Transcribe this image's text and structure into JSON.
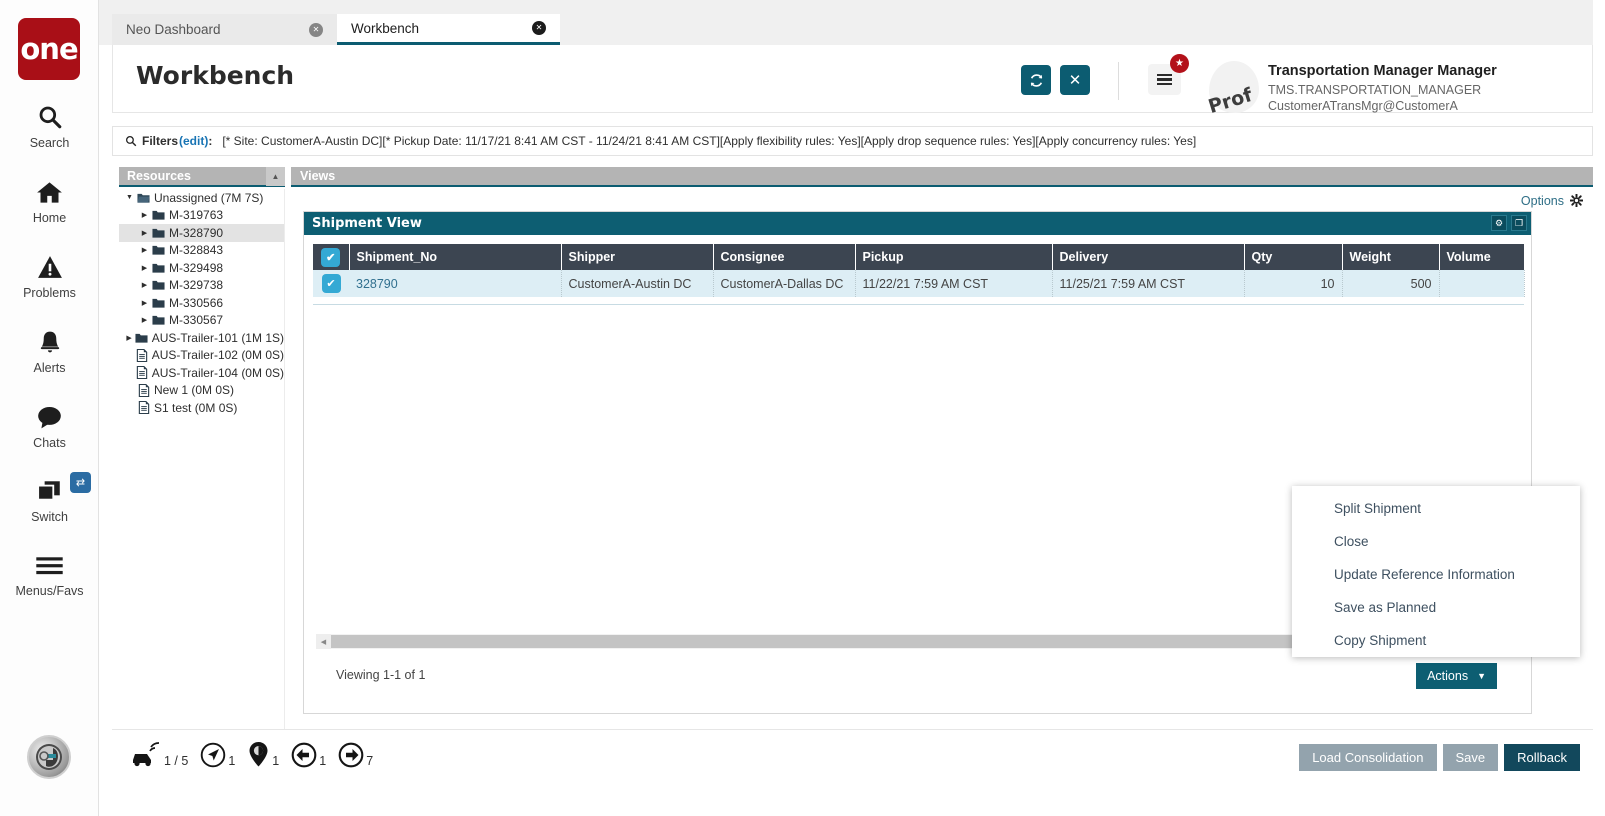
{
  "brand": {
    "logo_text": "one",
    "logo_color": "#a90f17"
  },
  "rail": {
    "items": [
      {
        "label": "Search",
        "icon": "search-icon"
      },
      {
        "label": "Home",
        "icon": "home-icon"
      },
      {
        "label": "Problems",
        "icon": "warning-triangle-icon"
      },
      {
        "label": "Alerts",
        "icon": "bell-icon"
      },
      {
        "label": "Chats",
        "icon": "chat-bubble-icon"
      },
      {
        "label": "Switch",
        "icon": "switch-windows-icon",
        "badge_icon": "swap-arrows-icon"
      },
      {
        "label": "Menus/Favs",
        "icon": "hamburger-icon"
      }
    ],
    "assistant_avatar": "ai-assistant-avatar"
  },
  "tabs": [
    {
      "label": "Neo Dashboard",
      "active": false
    },
    {
      "label": "Workbench",
      "active": true
    }
  ],
  "header": {
    "title": "Workbench",
    "refresh_icon": "refresh-icon",
    "close_icon": "close-icon",
    "menu_icon": "hamburger-icon",
    "badge_icon": "star-icon",
    "avatar_text": "Prof",
    "user_name": "Transportation Manager Manager",
    "user_role": "TMS.TRANSPORTATION_MANAGER",
    "user_email": "CustomerATransMgr@CustomerA",
    "caret_icon": "chevron-down-icon"
  },
  "filters": {
    "icon": "search-icon",
    "label": "Filters",
    "edit_link": "(edit)",
    "colon": ":",
    "value": "[* Site: CustomerA-Austin DC][* Pickup Date: 11/17/21 8:41 AM CST - 11/24/21 8:41 AM CST][Apply flexibility rules: Yes][Apply drop sequence rules: Yes][Apply concurrency rules: Yes]"
  },
  "panes": {
    "resources_header": "Resources",
    "resources_collapse_icon": "chevron-up-icon",
    "views_header": "Views"
  },
  "tree": [
    {
      "label": "Unassigned (7M 7S)",
      "depth": 0,
      "caret": "down",
      "icon": "folder-open-icon",
      "selected": false
    },
    {
      "label": "M-319763",
      "depth": 1,
      "caret": "right",
      "icon": "folder-icon",
      "selected": false
    },
    {
      "label": "M-328790",
      "depth": 1,
      "caret": "right",
      "icon": "folder-icon",
      "selected": true
    },
    {
      "label": "M-328843",
      "depth": 1,
      "caret": "right",
      "icon": "folder-icon",
      "selected": false
    },
    {
      "label": "M-329498",
      "depth": 1,
      "caret": "right",
      "icon": "folder-icon",
      "selected": false
    },
    {
      "label": "M-329738",
      "depth": 1,
      "caret": "right",
      "icon": "folder-icon",
      "selected": false
    },
    {
      "label": "M-330566",
      "depth": 1,
      "caret": "right",
      "icon": "folder-icon",
      "selected": false
    },
    {
      "label": "M-330567",
      "depth": 1,
      "caret": "right",
      "icon": "folder-icon",
      "selected": false
    },
    {
      "label": "AUS-Trailer-101 (1M 1S)",
      "depth": 0,
      "caret": "right",
      "icon": "folder-icon",
      "selected": false
    },
    {
      "label": "AUS-Trailer-102 (0M 0S)",
      "depth": 0,
      "caret": "none",
      "icon": "document-icon",
      "selected": false
    },
    {
      "label": "AUS-Trailer-104 (0M 0S)",
      "depth": 0,
      "caret": "none",
      "icon": "document-icon",
      "selected": false
    },
    {
      "label": "New 1 (0M 0S)",
      "depth": 0,
      "caret": "none",
      "icon": "document-icon",
      "selected": false
    },
    {
      "label": "S1 test (0M 0S)",
      "depth": 0,
      "caret": "none",
      "icon": "document-icon",
      "selected": false
    }
  ],
  "options": {
    "label": "Options",
    "icon": "gear-icon"
  },
  "panel": {
    "title": "Shipment View",
    "gear_icon": "gear-icon",
    "restore_icon": "restore-window-icon",
    "columns": [
      "Shipment_No",
      "Shipper",
      "Consignee",
      "Pickup",
      "Delivery",
      "Qty",
      "Weight",
      "Volume"
    ],
    "header_checkbox_checked": true,
    "rows": [
      {
        "checked": true,
        "Shipment_No": "328790",
        "Shipper": "CustomerA-Austin DC",
        "Consignee": "CustomerA-Dallas DC",
        "Pickup": "11/22/21 7:59 AM CST",
        "Delivery": "11/25/21 7:59 AM CST",
        "Qty": "10",
        "Weight": "500",
        "Volume": ""
      }
    ],
    "viewing": "Viewing 1-1 of 1",
    "actions_label": "Actions",
    "actions_caret": "caret-down-icon",
    "scroll_left_icon": "caret-left-icon"
  },
  "context_menu": [
    "Split Shipment",
    "Close",
    "Update Reference Information",
    "Save as Planned",
    "Copy Shipment"
  ],
  "bottom_stats": [
    {
      "icon": "vehicle-signal-icon",
      "value": "1 / 5"
    },
    {
      "icon": "navigation-arrow-icon",
      "value": "1"
    },
    {
      "icon": "map-pin-icon",
      "value": "1"
    },
    {
      "icon": "arrow-left-circle-icon",
      "value": "1"
    },
    {
      "icon": "arrow-right-circle-icon",
      "value": "7"
    }
  ],
  "bottom_buttons": [
    {
      "label": "Load Consolidation",
      "style": "grey"
    },
    {
      "label": "Save",
      "style": "grey"
    },
    {
      "label": "Rollback",
      "style": "dark"
    }
  ],
  "colors": {
    "teal": "#0d5e72",
    "brand_red": "#a90f17",
    "grid_header": "#3c4551",
    "row_selected": "#ddeef5",
    "checkbox": "#34a9d4",
    "pane_header": "#b4b4b4"
  }
}
